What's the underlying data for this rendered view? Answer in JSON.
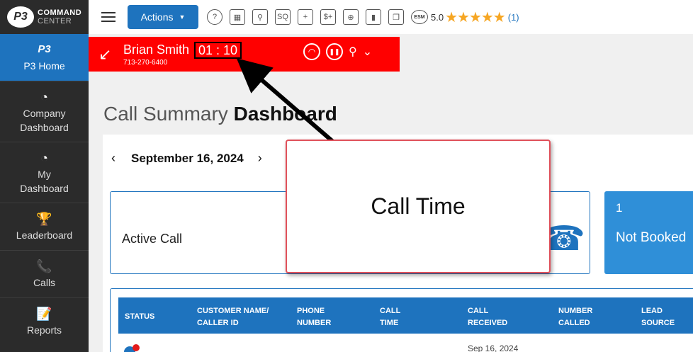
{
  "app": {
    "logo_mark": "P3",
    "logo_line1": "COMMAND",
    "logo_line2": "CENTER"
  },
  "sidebar": {
    "items": [
      {
        "label": "P3 Home",
        "icon": "p3-home-icon",
        "glyph": "P3"
      },
      {
        "label": "Company Dashboard",
        "icon": "speedometer-icon",
        "glyph": "◔"
      },
      {
        "label": "My Dashboard",
        "icon": "speedometer-icon",
        "glyph": "◔"
      },
      {
        "label": "Leaderboard",
        "icon": "trophy-icon",
        "glyph": "🏆"
      },
      {
        "label": "Calls",
        "icon": "phone-icon",
        "glyph": "📞"
      },
      {
        "label": "Reports",
        "icon": "report-icon",
        "glyph": "📝"
      }
    ]
  },
  "topbar": {
    "actions_label": "Actions",
    "tool_icons": [
      {
        "name": "help-icon",
        "glyph": "?"
      },
      {
        "name": "calendar-icon",
        "glyph": "▦"
      },
      {
        "name": "user-search-icon",
        "glyph": "⚲"
      },
      {
        "name": "sq-search-icon",
        "glyph": "SQ"
      },
      {
        "name": "add-user-icon",
        "glyph": "+"
      },
      {
        "name": "add-invoice-icon",
        "glyph": "$+"
      },
      {
        "name": "add-calendar-icon",
        "glyph": "⊕"
      },
      {
        "name": "chart-icon",
        "glyph": "▮"
      },
      {
        "name": "copy-icon",
        "glyph": "❐"
      }
    ],
    "esm_label": "ESM",
    "rating": "5.0",
    "stars": "★★★★★",
    "rating_count": "(1)"
  },
  "call": {
    "caller_name": "Brian Smith",
    "timer": "01 : 10",
    "caller_phone": "713-270-6400",
    "call_icon": "↙",
    "hangup_icon": "◠",
    "pause_icon": "❚❚",
    "person_icon": "⚲",
    "chevron_icon": "⌄"
  },
  "page": {
    "title_light": "Call Summary ",
    "title_bold": "Dashboard",
    "date": "September 16, 2024",
    "prev": "‹",
    "next": "›"
  },
  "cards": {
    "active_call_label": "Active Call",
    "not_booked_count": "1",
    "not_booked_label": "Not Booked"
  },
  "table": {
    "headers": [
      [
        "STATUS",
        ""
      ],
      [
        "CUSTOMER NAME/",
        "CALLER ID"
      ],
      [
        "PHONE",
        "NUMBER"
      ],
      [
        "CALL",
        "TIME"
      ],
      [
        "CALL",
        "RECEIVED"
      ],
      [
        "NUMBER",
        "CALLED"
      ],
      [
        "LEAD",
        "SOURCE"
      ]
    ],
    "row_received": "Sep 16, 2024"
  },
  "annotation": {
    "text": "Call Time"
  },
  "colors": {
    "brand_blue": "#1e73be",
    "call_red": "#ff0000",
    "star": "#f6a623",
    "sidebar": "#2b2b2b"
  }
}
